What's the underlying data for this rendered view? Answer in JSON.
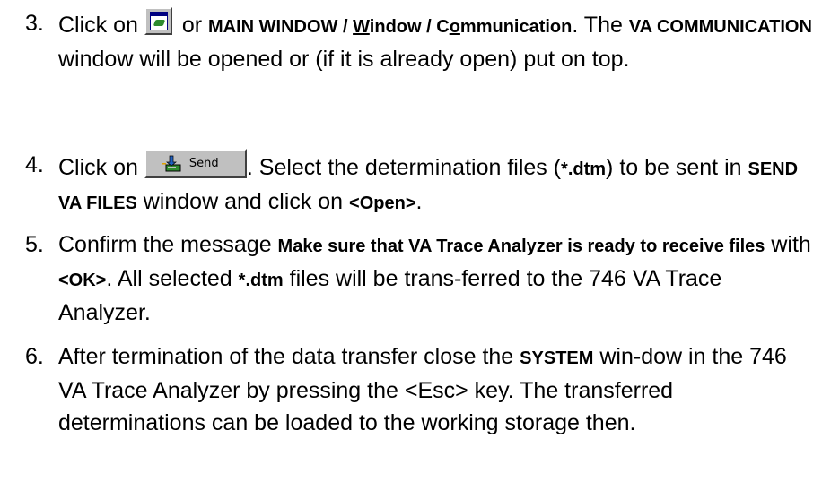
{
  "icons": {
    "communication_window_icon": "communication-window-icon",
    "send_icon": "send-icon"
  },
  "steps": [
    {
      "number": "3.",
      "t1": "Click on ",
      "t2": " or ",
      "path_main": "MAIN WINDOW / ",
      "path_w": "W",
      "path_indow": "indow / C",
      "path_o": "o",
      "path_mm": "mmunication",
      "t3": ". The ",
      "va_comm": "VA COMMUNICATION",
      "t4": " window will be opened or (if it is already open) put on top."
    },
    {
      "number": "4.",
      "t1": "Click on ",
      "send_label": "Send",
      "t2": ". Select the determination files (",
      "dtm": "*.dtm",
      "t3": ") to be sent in ",
      "send_va_files": "SEND VA FILES",
      "t4": " window and click on ",
      "open": "<Open>",
      "t5": "."
    },
    {
      "number": "5.",
      "t1": "Confirm the message ",
      "msg": "Make sure that VA Trace Analyzer is ready to receive files",
      "t2": " with ",
      "ok": "<OK>",
      "t3": ". All selected ",
      "dtm": "*.dtm",
      "t4": " files will be trans-ferred to the 746 VA Trace Analyzer."
    },
    {
      "number": "6.",
      "t1": "After termination of the data transfer close the ",
      "system": "SYSTEM",
      "t2": " win-dow in the 746 VA Trace Analyzer by pressing the <Esc> key. The transferred determinations can be loaded to the working storage then."
    }
  ]
}
